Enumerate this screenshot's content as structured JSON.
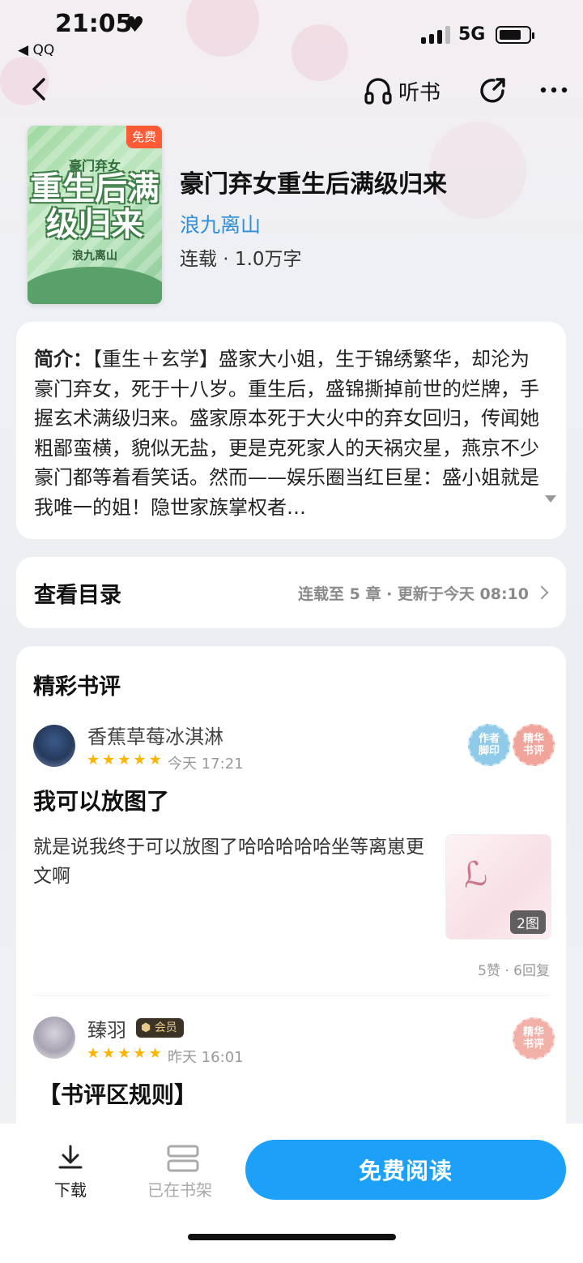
{
  "status_bar": {
    "time": "21:05",
    "back_app": "QQ",
    "network": "5G"
  },
  "nav": {
    "listen_label": "听书"
  },
  "book": {
    "cover_badge": "免费",
    "cover_tag": "豪门弃女",
    "cover_title": "重生后满级归来",
    "cover_author": "浪九离山",
    "title": "豪门弃女重生后满级归来",
    "author": "浪九离山",
    "meta": "连载 · 1.0万字"
  },
  "intro": {
    "label": "简介：",
    "text": "【重生＋玄学】盛家大小姐，生于锦绣繁华，却沦为豪门弃女，死于十八岁。重生后，盛锦撕掉前世的烂牌，手握玄术满级归来。盛家原本死于大火中的弃女回归，传闻她粗鄙蛮横，貌似无盐，更是克死家人的天祸灾星，燕京不少豪门都等着看笑话。然而——娱乐圈当红巨星：盛小姐就是我唯一的姐！隐世家族掌权者…"
  },
  "catalog": {
    "title": "查看目录",
    "meta": "连载至 5 章 · 更新于今天 08:10"
  },
  "reviews": {
    "header": "精彩书评",
    "items": [
      {
        "user": "香蕉草莓冰淇淋",
        "stars": 5,
        "time": "今天 17:21",
        "stamps": [
          "作者\n脚印",
          "精华\n书评"
        ],
        "title": "我可以放图了",
        "body": "就是说我终于可以放图了哈哈哈哈哈坐等离崽更文啊",
        "image_count": "2图",
        "stats": "5赞 · 6回复"
      },
      {
        "user": "臻羽",
        "vip_label": "会员",
        "stars": 5,
        "time": "昨天 16:01",
        "stamps": [
          "精华\n书评"
        ],
        "title": "【书评区规则】"
      }
    ]
  },
  "bottom": {
    "download_label": "下载",
    "shelf_label": "已在书架",
    "read_label": "免费阅读"
  },
  "colors": {
    "accent": "#1da1f8",
    "author_link": "#2f8fd8",
    "free_badge": "#ff5a36",
    "star": "#ffb400"
  }
}
